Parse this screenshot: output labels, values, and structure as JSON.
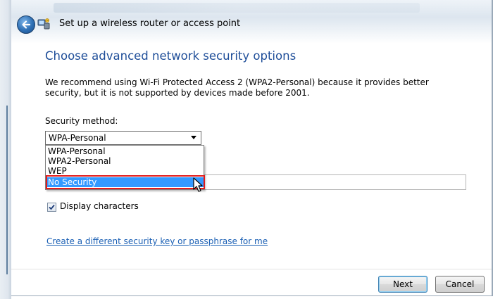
{
  "window": {
    "title": "Set up a wireless router or access point"
  },
  "main": {
    "heading": "Choose advanced network security options",
    "description": "We recommend using Wi-Fi Protected Access 2 (WPA2-Personal) because it provides better security,  but it is not supported by devices made before 2001.",
    "security_method_label": "Security method:",
    "security_method_value": "WPA-Personal",
    "dropdown_options": [
      "WPA-Personal",
      "WPA2-Personal",
      "WEP",
      "No Security"
    ],
    "display_characters_label": "Display characters",
    "display_characters_checked": true,
    "link_text": "Create a different security key or passphrase for me"
  },
  "footer": {
    "next_label": "Next",
    "cancel_label": "Cancel"
  },
  "icons": {
    "back": "back-arrow-icon",
    "wizard": "network-wizard-icon",
    "cursor": "mouse-pointer-icon",
    "dropdown": "chevron-down-icon",
    "check": "checkmark-icon"
  },
  "colors": {
    "heading": "#1f4e99",
    "link": "#1a5fb4",
    "selection": "#3399ff",
    "highlight_box": "#e21b1b"
  }
}
